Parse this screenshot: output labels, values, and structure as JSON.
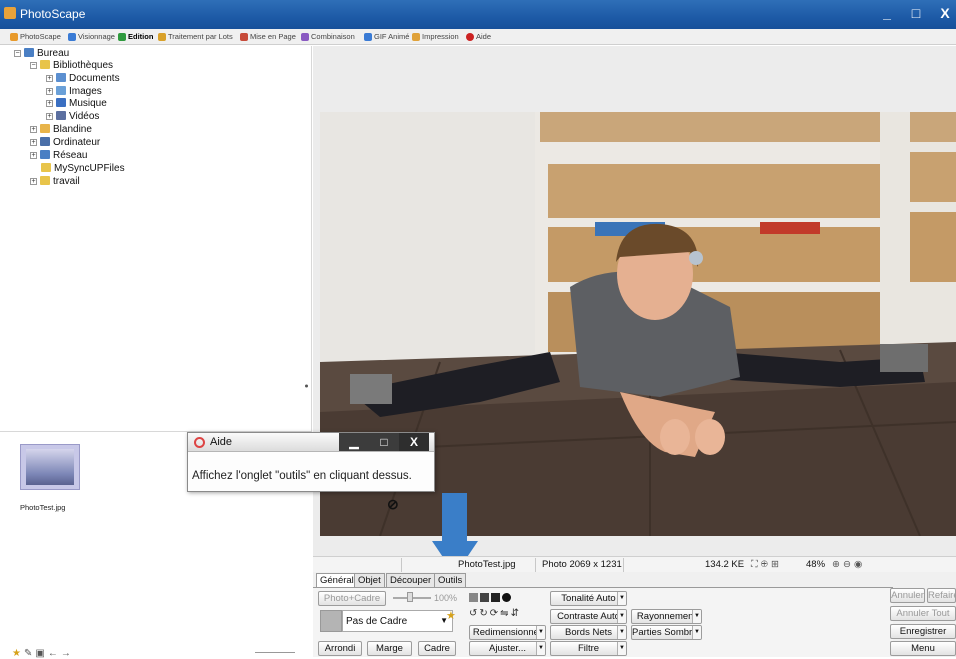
{
  "window": {
    "title": "PhotoScape",
    "controls": [
      "_",
      "□",
      "X"
    ]
  },
  "menu_tabs": [
    {
      "label": "PhotoScape",
      "color": "#e89a2b"
    },
    {
      "label": "Visionnage",
      "color": "#3a7bd5"
    },
    {
      "label": "Edition",
      "color": "#2f9a3e",
      "active": true
    },
    {
      "label": "Traitement par Lots",
      "color": "#d9a12a"
    },
    {
      "label": "Mise en Page",
      "color": "#c74b3a"
    },
    {
      "label": "Combinaison",
      "color": "#8a5ac2"
    },
    {
      "label": "GIF Animé",
      "color": "#3a7bd5"
    },
    {
      "label": "Impression",
      "color": "#e0a23a"
    },
    {
      "label": "Aide",
      "color": "#cc2222"
    }
  ],
  "tree": [
    {
      "label": "Bureau",
      "color": "#4a7fc4",
      "exp": "−"
    },
    {
      "label": "Bibliothèques",
      "color": "#e8c44a",
      "exp": "−"
    },
    {
      "label": "Documents",
      "color": "#5b8fd0",
      "exp": "+"
    },
    {
      "label": "Images",
      "color": "#6aa0d8",
      "exp": "+"
    },
    {
      "label": "Musique",
      "color": "#3a6fc2",
      "exp": "+"
    },
    {
      "label": "Vidéos",
      "color": "#5b6fa0",
      "exp": "+"
    },
    {
      "label": "Blandine",
      "color": "#e8b44a",
      "exp": "+"
    },
    {
      "label": "Ordinateur",
      "color": "#4a6fa8",
      "exp": "+"
    },
    {
      "label": "Réseau",
      "color": "#4a7fc4",
      "exp": "+"
    },
    {
      "label": "MySyncUPFiles",
      "color": "#e8c44a",
      "exp": ""
    },
    {
      "label": "travail",
      "color": "#e8c44a",
      "exp": "+"
    }
  ],
  "thumbnail": {
    "filename": "PhotoTest.jpg"
  },
  "help_popup": {
    "title": "Aide",
    "message": "Affichez l'onglet \"outils\" en cliquant dessus.",
    "controls": [
      "▁",
      "□",
      "X"
    ]
  },
  "status": {
    "filename": "PhotoTest.jpg",
    "dimensions": "Photo 2069 x 1231",
    "filesize": "134.2 KE",
    "zoom": "48%"
  },
  "tool_tabs": [
    "Général",
    "Objet",
    "Découper",
    "Outils"
  ],
  "tools": {
    "photo_cadre": "Photo+Cadre",
    "percent": "100%",
    "frame_value": "Pas de Cadre",
    "arrondi": "Arrondi",
    "marge": "Marge",
    "cadre": "Cadre",
    "tonalite": "Tonalité Auto",
    "contraste": "Contraste Auto",
    "rayonnement": "Rayonnement",
    "redimensionner": "Redimensionner",
    "bords_nets": "Bords Nets",
    "parties_sombres": "Parties Sombres",
    "ajuster": "Ajuster...",
    "filtre": "Filtre"
  },
  "actions": {
    "annuler": "Annuler",
    "refaire": "Refaire",
    "annuler_tout": "Annuler Tout",
    "enregistrer": "Enregistrer",
    "menu": "Menu"
  },
  "colors": {
    "titlebar": "#1d5aa6",
    "arrow": "#3a7ec8"
  }
}
